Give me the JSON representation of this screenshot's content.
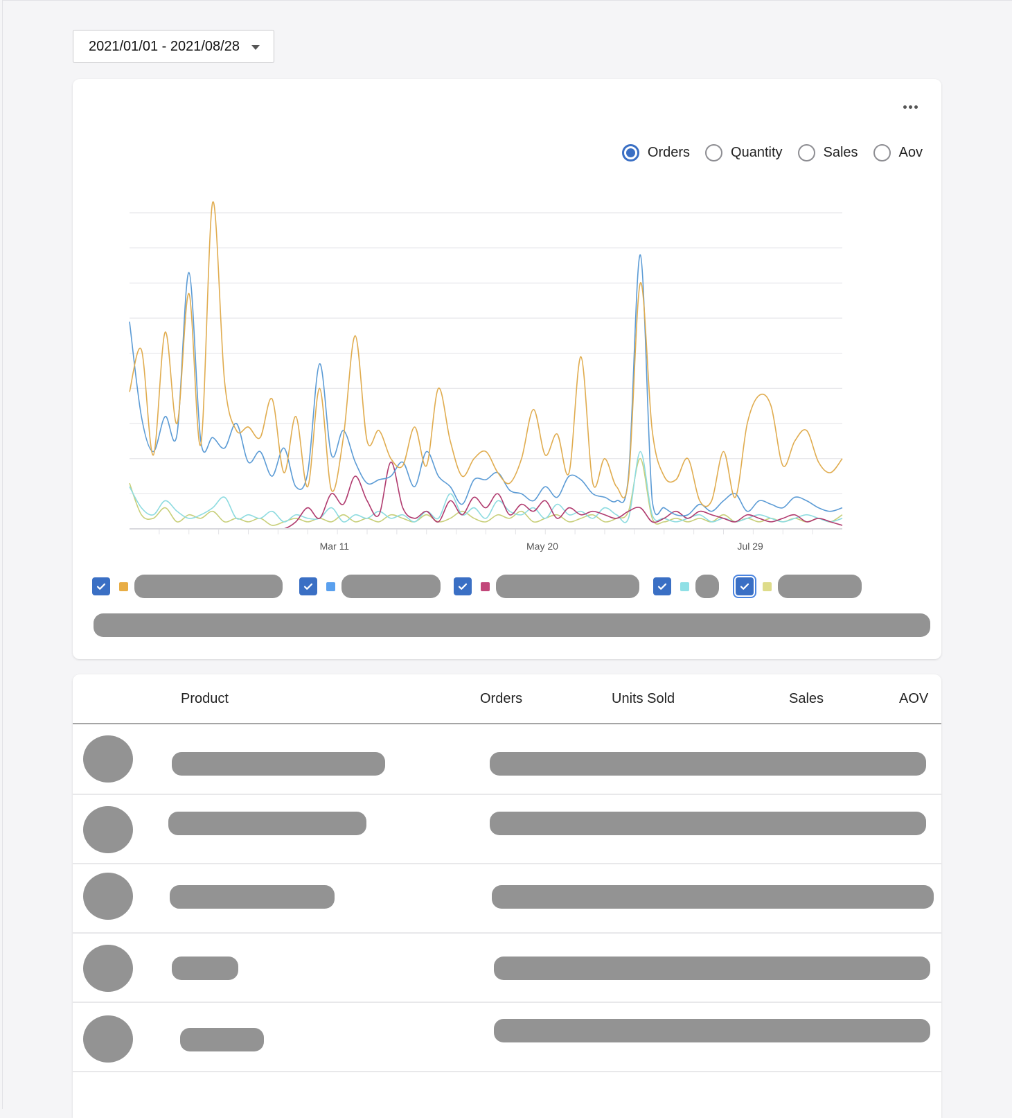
{
  "date_range": {
    "label": "2021/01/01 - 2021/08/28",
    "start": "2021-01-01",
    "end": "2021-08-28"
  },
  "chart_card": {
    "more_menu_icon": "ellipsis-horizontal-icon",
    "metrics": [
      {
        "label": "Orders",
        "selected": true
      },
      {
        "label": "Quantity",
        "selected": false
      },
      {
        "label": "Sales",
        "selected": false
      },
      {
        "label": "Aov",
        "selected": false
      }
    ],
    "legend": [
      {
        "checked": true,
        "color": "#e8ad45",
        "label_redacted": true
      },
      {
        "checked": true,
        "color": "#5aa0ee",
        "label_redacted": true
      },
      {
        "checked": true,
        "color": "#c2477a",
        "label_redacted": true
      },
      {
        "checked": true,
        "color": "#8fe0e6",
        "label_redacted": true
      },
      {
        "checked": true,
        "color": "#dedc8a",
        "label_redacted": true,
        "focused": true
      }
    ]
  },
  "chart_data": {
    "type": "line",
    "title": "",
    "xlabel": "",
    "ylabel": "",
    "x_start": "2021-01-01",
    "x_step_days": 4,
    "x_ticks": [
      {
        "label": "Mar 11",
        "day": 69
      },
      {
        "label": "May 20",
        "day": 139
      },
      {
        "label": "Jul 29",
        "day": 209
      }
    ],
    "x_range_days": [
      0,
      240
    ],
    "ylim": [
      0,
      9
    ],
    "y_gridlines": 9,
    "y_tick_labels_visible": false,
    "grid": true,
    "legend_position": "bottom",
    "series": [
      {
        "name": "Series 1 (orange)",
        "color": "#e0ac4f",
        "values": [
          3.9,
          5.1,
          2.1,
          5.6,
          3.0,
          6.7,
          2.4,
          9.3,
          4.2,
          2.8,
          2.9,
          2.6,
          3.7,
          1.6,
          3.2,
          1.2,
          4.0,
          1.1,
          2.6,
          5.5,
          2.5,
          2.8,
          2.0,
          1.8,
          2.9,
          1.8,
          4.0,
          2.5,
          1.5,
          2.0,
          2.2,
          1.6,
          1.3,
          2.0,
          3.4,
          2.1,
          2.7,
          1.6,
          4.9,
          1.3,
          2.0,
          1.2,
          1.4,
          7.0,
          2.8,
          1.5,
          1.4,
          2.0,
          0.8,
          0.8,
          2.2,
          0.9,
          3.0,
          3.8,
          3.5,
          1.8,
          2.5,
          2.8,
          1.9,
          1.6,
          2.0
        ]
      },
      {
        "name": "Series 2 (blue)",
        "color": "#5b9bd5",
        "values": [
          5.9,
          3.2,
          2.2,
          3.2,
          2.7,
          7.3,
          2.5,
          2.6,
          2.3,
          3.0,
          1.9,
          2.2,
          1.5,
          2.3,
          1.2,
          1.6,
          4.7,
          2.1,
          2.8,
          1.9,
          1.3,
          1.4,
          1.5,
          1.9,
          1.2,
          2.2,
          1.5,
          1.2,
          0.7,
          1.4,
          1.4,
          1.6,
          1.1,
          1.0,
          0.8,
          1.2,
          0.9,
          1.5,
          1.4,
          1.0,
          0.9,
          0.8,
          1.5,
          7.8,
          0.8,
          0.6,
          0.4,
          0.4,
          0.7,
          0.5,
          0.8,
          1.0,
          0.5,
          0.8,
          0.7,
          0.6,
          0.9,
          0.8,
          0.6,
          0.5,
          0.6
        ]
      },
      {
        "name": "Series 3 (magenta)",
        "color": "#b03a6e",
        "values": [
          0,
          0,
          0,
          0,
          0,
          0,
          0,
          0,
          0,
          0,
          0,
          0,
          0,
          0,
          0.2,
          0.6,
          0.3,
          1.0,
          0.7,
          1.5,
          0.8,
          0.4,
          1.9,
          0.6,
          0.3,
          0.5,
          0.2,
          0.8,
          0.4,
          0.9,
          0.6,
          1.0,
          0.4,
          0.7,
          0.5,
          0.8,
          0.3,
          0.6,
          0.4,
          0.5,
          0.4,
          0.3,
          0.5,
          0.6,
          0.2,
          0.3,
          0.5,
          0.3,
          0.5,
          0.4,
          0.3,
          0.2,
          0.4,
          0.3,
          0.2,
          0.3,
          0.4,
          0.2,
          0.3,
          0.2,
          0.1
        ]
      },
      {
        "name": "Series 4 (cyan)",
        "color": "#8ddbe0",
        "values": [
          1.2,
          0.6,
          0.4,
          0.8,
          0.5,
          0.3,
          0.4,
          0.6,
          0.9,
          0.3,
          0.4,
          0.3,
          0.5,
          0.2,
          0.4,
          0.3,
          0.3,
          0.6,
          0.2,
          0.4,
          0.3,
          0.5,
          0.3,
          0.4,
          0.2,
          0.5,
          0.3,
          1.0,
          0.4,
          0.6,
          0.3,
          0.8,
          0.5,
          0.4,
          0.6,
          0.3,
          0.7,
          0.4,
          0.5,
          0.3,
          0.6,
          0.4,
          0.3,
          2.2,
          0.4,
          0.3,
          0.2,
          0.3,
          0.4,
          0.2,
          0.3,
          0.2,
          0.3,
          0.4,
          0.3,
          0.2,
          0.3,
          0.4,
          0.3,
          0.2,
          0.3
        ]
      },
      {
        "name": "Series 5 (yellow-green)",
        "color": "#c8cf7a",
        "values": [
          1.3,
          0.4,
          0.3,
          0.6,
          0.2,
          0.4,
          0.3,
          0.5,
          0.2,
          0.3,
          0.2,
          0.3,
          0.1,
          0.2,
          0.3,
          0.2,
          0.3,
          0.2,
          0.4,
          0.2,
          0.3,
          0.2,
          0.4,
          0.3,
          0.2,
          0.4,
          0.2,
          0.3,
          0.5,
          0.3,
          0.2,
          0.4,
          0.3,
          0.5,
          0.2,
          0.3,
          0.4,
          0.2,
          0.3,
          0.4,
          0.2,
          0.3,
          0.5,
          2.0,
          0.3,
          0.2,
          0.3,
          0.2,
          0.3,
          0.2,
          0.4,
          0.2,
          0.3,
          0.2,
          0.3,
          0.2,
          0.3,
          0.2,
          0.3,
          0.2,
          0.4
        ]
      }
    ]
  },
  "table": {
    "columns": [
      "Product",
      "Orders",
      "Units Sold",
      "Sales",
      "AOV"
    ],
    "rows": [
      {
        "product_redacted": true,
        "values_redacted": true
      },
      {
        "product_redacted": true,
        "values_redacted": true
      },
      {
        "product_redacted": true,
        "values_redacted": true
      },
      {
        "product_redacted": true,
        "values_redacted": true
      },
      {
        "product_redacted": true,
        "values_redacted": true
      }
    ]
  }
}
